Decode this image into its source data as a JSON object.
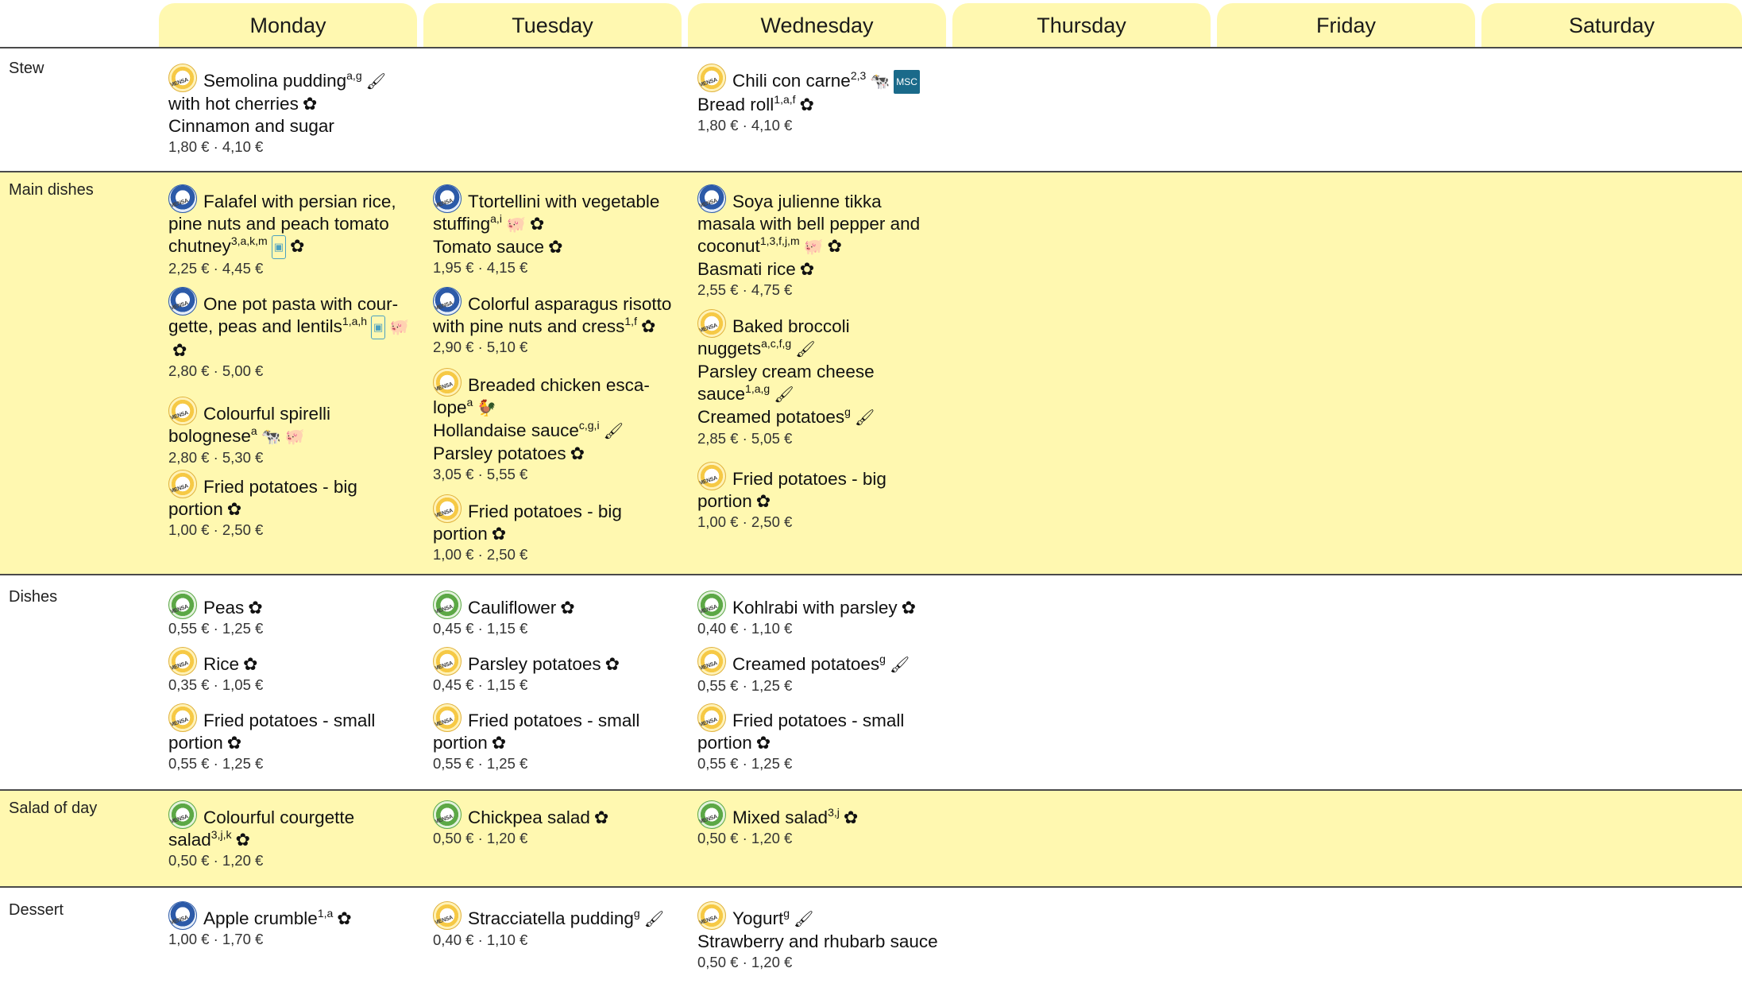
{
  "days": [
    "Monday",
    "Tuesday",
    "Wednesday",
    "Thursday",
    "Friday",
    "Saturday"
  ],
  "categories": {
    "stew": "Stew",
    "main": "Main dishes",
    "dishes": "Dishes",
    "salad": "Salad of day",
    "dessert": "Dessert"
  },
  "colors": {
    "header_bg": "#fff8b0",
    "row_highlight": "#fff8b0",
    "rule": "#4a4a4a"
  },
  "icons": {
    "vegetarian": "flower-icon",
    "dairy": "paintbrush-icon",
    "beef": "cow-icon",
    "poultry": "chicken-icon",
    "pork": "pig-icon",
    "climate": "climate-plate-icon",
    "fish": "msc-icon"
  },
  "items": [
    {
      "id": "stew-mon",
      "day": "Monday",
      "logo": "classic",
      "dish": "Semolina pudding",
      "sup": "a,g",
      "icons": [
        "paintbrush-icon"
      ],
      "extras": [
        {
          "text": "with hot cherries",
          "sup": "",
          "icons": [
            "flower-icon"
          ]
        },
        {
          "text": "Cinnamon and sugar",
          "sup": "",
          "icons": []
        }
      ],
      "price": "1,80 € · 4,10 €"
    },
    {
      "id": "stew-wed",
      "day": "Wednesday",
      "logo": "classic",
      "dish": "Chili con carne",
      "sup": "2,3",
      "icons": [
        "cow-icon",
        "msc-icon"
      ],
      "extras": [
        {
          "text": "Bread roll",
          "sup": "1,a,f",
          "icons": [
            "flower-icon"
          ]
        }
      ],
      "price": "1,80 € · 4,10 €"
    },
    {
      "id": "main-mon-1",
      "day": "Monday",
      "logo": "global",
      "dish": "Falafel with persian rice, pine nuts and peach tomato chutney",
      "sup": "3,a,k,m",
      "icons": [
        "climate-plate-icon",
        "flower-icon"
      ],
      "extras": [],
      "price": "2,25 € · 4,45 €"
    },
    {
      "id": "main-mon-2",
      "day": "Monday",
      "logo": "global",
      "dish": "One pot pasta with cour-gette, peas and lentils",
      "sup": "1,a,h",
      "icons": [
        "climate-plate-icon",
        "pig-icon",
        "flower-icon"
      ],
      "extras": [],
      "price": "2,80 € · 5,00 €"
    },
    {
      "id": "main-mon-3",
      "day": "Monday",
      "logo": "classic",
      "dish": "Colourful spirelli bolognese",
      "sup": "a",
      "icons": [
        "cow-icon",
        "pig-icon"
      ],
      "extras": [],
      "price": "2,80 € · 5,30 €"
    },
    {
      "id": "main-mon-4",
      "day": "Monday",
      "logo": "classic",
      "dish": "Fried potatoes - big portion",
      "sup": "",
      "icons": [
        "flower-icon"
      ],
      "extras": [],
      "price": "1,00 € · 2,50 €"
    },
    {
      "id": "main-tue-1",
      "day": "Tuesday",
      "logo": "global",
      "dish": "Ttortellini with vegetable stuffing",
      "sup": "a,i",
      "icons": [
        "pig-icon",
        "flower-icon"
      ],
      "extras": [
        {
          "text": "Tomato sauce",
          "sup": "",
          "icons": [
            "flower-icon"
          ]
        }
      ],
      "price": "1,95 € · 4,15 €"
    },
    {
      "id": "main-tue-2",
      "day": "Tuesday",
      "logo": "global",
      "dish": "Colorful asparagus risotto with pine nuts and cress",
      "sup": "1,f",
      "icons": [
        "flower-icon"
      ],
      "extras": [],
      "price": "2,90 € · 5,10 €"
    },
    {
      "id": "main-tue-3",
      "day": "Tuesday",
      "logo": "classic",
      "dish": "Breaded chicken esca-lope",
      "sup": "a",
      "icons": [
        "chicken-icon"
      ],
      "extras": [
        {
          "text": "Hollandaise sauce",
          "sup": "c,g,i",
          "icons": [
            "paintbrush-icon"
          ]
        },
        {
          "text": "Parsley potatoes",
          "sup": "",
          "icons": [
            "flower-icon"
          ]
        }
      ],
      "price": "3,05 € · 5,55 €"
    },
    {
      "id": "main-tue-4",
      "day": "Tuesday",
      "logo": "classic",
      "dish": "Fried potatoes - big portion",
      "sup": "",
      "icons": [
        "flower-icon"
      ],
      "extras": [],
      "price": "1,00 € · 2,50 €"
    },
    {
      "id": "main-wed-1",
      "day": "Wednesday",
      "logo": "global",
      "dish": "Soya julienne tikka masala with bell pepper and coconut",
      "sup": "1,3,f,j,m",
      "icons": [
        "pig-icon",
        "flower-icon"
      ],
      "extras": [
        {
          "text": "Basmati rice",
          "sup": "",
          "icons": [
            "flower-icon"
          ]
        }
      ],
      "price": "2,55 € · 4,75 €"
    },
    {
      "id": "main-wed-2",
      "day": "Wednesday",
      "logo": "classic",
      "dish": "Baked broccoli nuggets",
      "sup": "a,c,f,g",
      "icons": [
        "paintbrush-icon"
      ],
      "extras": [
        {
          "text": "Parsley cream cheese sauce",
          "sup": "1,a,g",
          "icons": [
            "paintbrush-icon"
          ]
        },
        {
          "text": "Creamed potatoes",
          "sup": "g",
          "icons": [
            "paintbrush-icon"
          ]
        }
      ],
      "price": "2,85 € · 5,05 €"
    },
    {
      "id": "main-wed-3",
      "day": "Wednesday",
      "logo": "classic",
      "dish": "Fried potatoes - big portion",
      "sup": "",
      "icons": [
        "flower-icon"
      ],
      "extras": [],
      "price": "1,00 € · 2,50 €"
    },
    {
      "id": "dish-mon-1",
      "day": "Monday",
      "logo": "active",
      "dish": "Peas",
      "sup": "",
      "icons": [
        "flower-icon"
      ],
      "extras": [],
      "price": "0,55 € · 1,25 €"
    },
    {
      "id": "dish-mon-2",
      "day": "Monday",
      "logo": "classic",
      "dish": "Rice",
      "sup": "",
      "icons": [
        "flower-icon"
      ],
      "extras": [],
      "price": "0,35 € · 1,05 €"
    },
    {
      "id": "dish-mon-3",
      "day": "Monday",
      "logo": "classic",
      "dish": "Fried potatoes - small portion",
      "sup": "",
      "icons": [
        "flower-icon"
      ],
      "extras": [],
      "price": "0,55 € · 1,25 €"
    },
    {
      "id": "dish-tue-1",
      "day": "Tuesday",
      "logo": "active",
      "dish": "Cauliflower",
      "sup": "",
      "icons": [
        "flower-icon"
      ],
      "extras": [],
      "price": "0,45 € · 1,15 €"
    },
    {
      "id": "dish-tue-2",
      "day": "Tuesday",
      "logo": "classic",
      "dish": "Parsley potatoes",
      "sup": "",
      "icons": [
        "flower-icon"
      ],
      "extras": [],
      "price": "0,45 € · 1,15 €"
    },
    {
      "id": "dish-tue-3",
      "day": "Tuesday",
      "logo": "classic",
      "dish": "Fried potatoes - small portion",
      "sup": "",
      "icons": [
        "flower-icon"
      ],
      "extras": [],
      "price": "0,55 € · 1,25 €"
    },
    {
      "id": "dish-wed-1",
      "day": "Wednesday",
      "logo": "active",
      "dish": "Kohlrabi with parsley",
      "sup": "",
      "icons": [
        "flower-icon"
      ],
      "extras": [],
      "price": "0,40 € · 1,10 €"
    },
    {
      "id": "dish-wed-2",
      "day": "Wednesday",
      "logo": "classic",
      "dish": "Creamed potatoes",
      "sup": "g",
      "icons": [
        "paintbrush-icon"
      ],
      "extras": [],
      "price": "0,55 € · 1,25 €"
    },
    {
      "id": "dish-wed-3",
      "day": "Wednesday",
      "logo": "classic",
      "dish": "Fried potatoes - small portion",
      "sup": "",
      "icons": [
        "flower-icon"
      ],
      "extras": [],
      "price": "0,55 € · 1,25 €"
    },
    {
      "id": "salad-mon",
      "day": "Monday",
      "logo": "active",
      "dish": "Colourful courgette salad",
      "sup": "3,j,k",
      "icons": [
        "flower-icon"
      ],
      "extras": [],
      "price": "0,50 € · 1,20 €"
    },
    {
      "id": "salad-tue",
      "day": "Tuesday",
      "logo": "active",
      "dish": "Chickpea salad",
      "sup": "",
      "icons": [
        "flower-icon"
      ],
      "extras": [],
      "price": "0,50 € · 1,20 €"
    },
    {
      "id": "salad-wed",
      "day": "Wednesday",
      "logo": "active",
      "dish": "Mixed salad",
      "sup": "3,j",
      "icons": [
        "flower-icon"
      ],
      "extras": [],
      "price": "0,50 € · 1,20 €"
    },
    {
      "id": "dessert-mon",
      "day": "Monday",
      "logo": "global",
      "dish": "Apple crumble",
      "sup": "1,a",
      "icons": [
        "flower-icon"
      ],
      "extras": [],
      "price": "1,00 € · 1,70 €"
    },
    {
      "id": "dessert-tue",
      "day": "Tuesday",
      "logo": "classic",
      "dish": "Stracciatella pudding",
      "sup": "g",
      "icons": [
        "paintbrush-icon"
      ],
      "extras": [],
      "price": "0,40 € · 1,10 €"
    },
    {
      "id": "dessert-wed",
      "day": "Wednesday",
      "logo": "classic",
      "dish": "Yogurt",
      "sup": "g",
      "icons": [
        "paintbrush-icon"
      ],
      "extras": [
        {
          "text": "Strawberry and rhubarb sauce",
          "sup": "",
          "icons": []
        }
      ],
      "price": "0,50 € · 1,20 €"
    }
  ]
}
